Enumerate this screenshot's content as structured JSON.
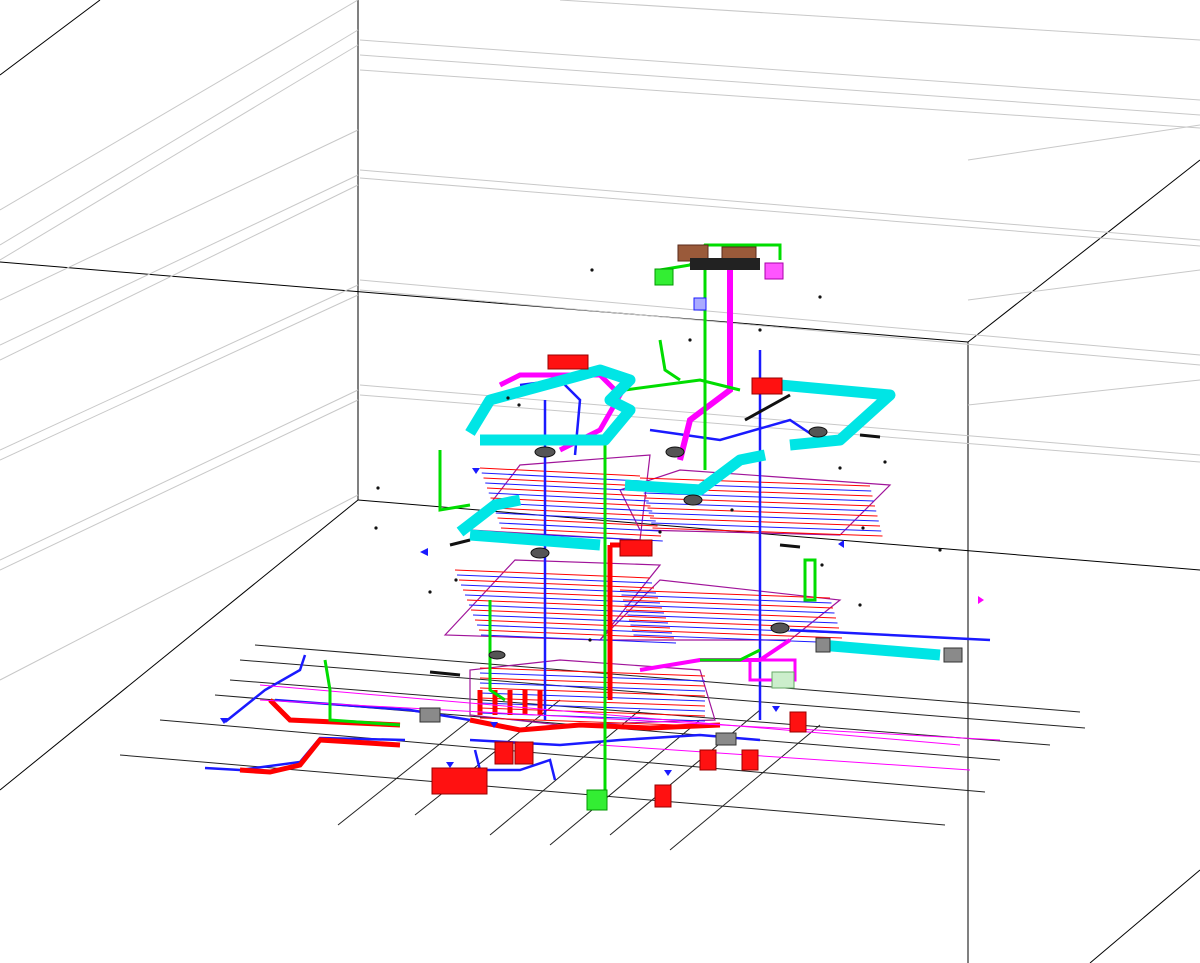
{
  "view": {
    "background": "#ffffff",
    "kind": "3D MEP model isometric view"
  },
  "colors": {
    "edge": "#000000",
    "faint_edge": "#c8c8c8",
    "supply_duct": "#00e5e5",
    "return_pipe": "#ff00ff",
    "hot_water": "#ff0000",
    "cold_water": "#1a1aff",
    "vent": "#00dd00",
    "equipment": "#9a5a3a",
    "mixed_coil": "#a0149a",
    "fixture_grey": "#8a8a8a"
  },
  "icons": [
    "ahu-unit-icon",
    "fan-coil-icon",
    "pump-icon",
    "valve-icon",
    "diffuser-icon",
    "equipment-box-icon"
  ],
  "systems": [
    "supply-duct-system",
    "return-duct-system",
    "heating-water-system",
    "domestic-water-system",
    "ventilation-riser-system",
    "radiant-floor-loop-system"
  ]
}
